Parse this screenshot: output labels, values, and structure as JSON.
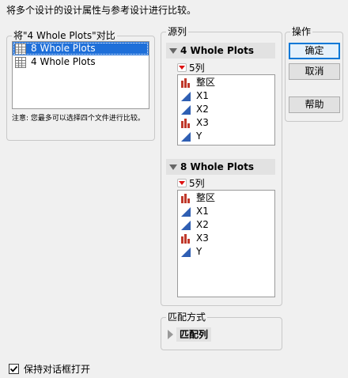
{
  "instruction": "将多个设计的设计属性与参考设计进行比较。",
  "compare_group": {
    "legend": "将\"4 Whole Plots\"对比",
    "items": [
      {
        "label": "8 Whole Plots",
        "selected": true
      },
      {
        "label": "4 Whole Plots",
        "selected": false
      }
    ],
    "note": "注意: 您最多可以选择四个文件进行比较。"
  },
  "source_group": {
    "legend": "源列",
    "tables": [
      {
        "name": "4 Whole Plots",
        "count_label": "5列",
        "columns": [
          {
            "name": "整区",
            "icon": "nominal-red-bars-icon"
          },
          {
            "name": "X1",
            "icon": "continuous-blue-triangle-icon"
          },
          {
            "name": "X2",
            "icon": "continuous-blue-triangle-icon"
          },
          {
            "name": "X3",
            "icon": "nominal-red-bars-icon"
          },
          {
            "name": "Y",
            "icon": "continuous-blue-triangle-icon"
          }
        ]
      },
      {
        "name": "8 Whole Plots",
        "count_label": "5列",
        "columns": [
          {
            "name": "整区",
            "icon": "nominal-red-bars-icon"
          },
          {
            "name": "X1",
            "icon": "continuous-blue-triangle-icon"
          },
          {
            "name": "X2",
            "icon": "continuous-blue-triangle-icon"
          },
          {
            "name": "X3",
            "icon": "nominal-red-bars-icon"
          },
          {
            "name": "Y",
            "icon": "continuous-blue-triangle-icon"
          }
        ]
      }
    ]
  },
  "actions": {
    "legend": "操作",
    "ok": "确定",
    "cancel": "取消",
    "help": "帮助"
  },
  "match": {
    "legend": "匹配方式",
    "match_columns": "匹配列"
  },
  "keep_open": {
    "label": "保持对话框打开",
    "checked": true
  },
  "colors": {
    "selection": "#1e6fd9",
    "nominal": "#c0392b",
    "continuous": "#2f5fb3"
  }
}
